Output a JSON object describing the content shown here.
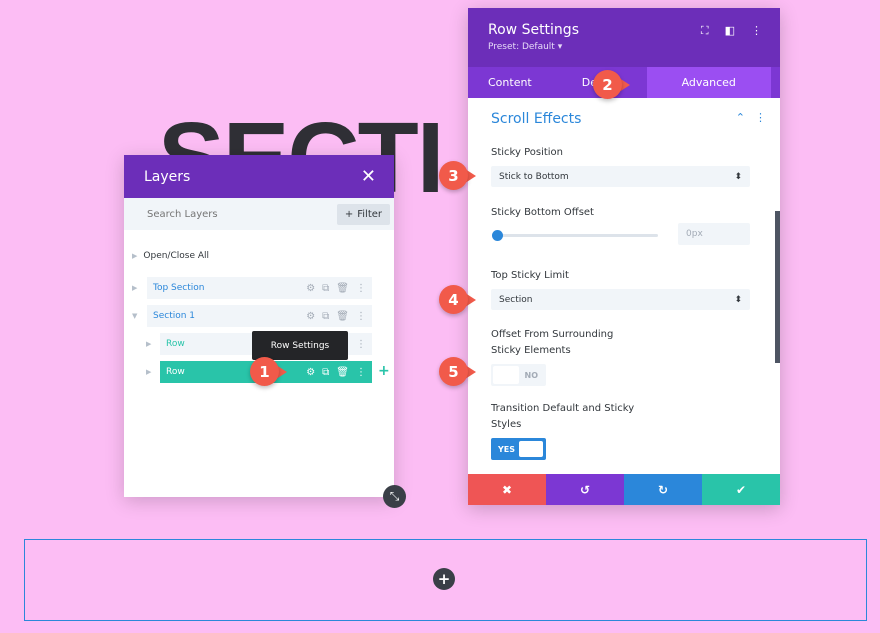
{
  "background_heading": "SECTI",
  "layers": {
    "title": "Layers",
    "close_glyph": "✕",
    "search_placeholder": "Search Layers",
    "filter_label": "Filter",
    "open_close_all": "Open/Close All",
    "items": [
      {
        "label": "Top Section",
        "kind": "section"
      },
      {
        "label": "Section 1",
        "kind": "section"
      },
      {
        "label": "Row",
        "kind": "row"
      },
      {
        "label": "Row",
        "kind": "row",
        "active": true
      }
    ]
  },
  "tooltip": "Row Settings",
  "settings": {
    "title": "Row Settings",
    "preset": "Preset: Default ▾",
    "tabs": {
      "content": "Content",
      "design": "Des",
      "advanced": "Advanced"
    },
    "section_title": "Scroll Effects",
    "sticky_position": {
      "label": "Sticky Position",
      "value": "Stick to Bottom"
    },
    "sticky_bottom_offset": {
      "label": "Sticky Bottom Offset",
      "value": "0px"
    },
    "top_sticky_limit": {
      "label": "Top Sticky Limit",
      "value": "Section"
    },
    "offset_surrounding": {
      "label_line1": "Offset From Surrounding",
      "label_line2": "Sticky Elements",
      "state": "NO"
    },
    "transition": {
      "label_line1": "Transition Default and Sticky",
      "label_line2": "Styles",
      "state": "YES"
    }
  },
  "callouts": [
    "1",
    "2",
    "3",
    "4",
    "5"
  ],
  "colors": {
    "page_bg": "#fcbdf4",
    "purple_header": "#6c2eb9",
    "accent_blue": "#2b87da",
    "accent_green": "#29c4a9",
    "callout_red": "#f15a4a"
  }
}
